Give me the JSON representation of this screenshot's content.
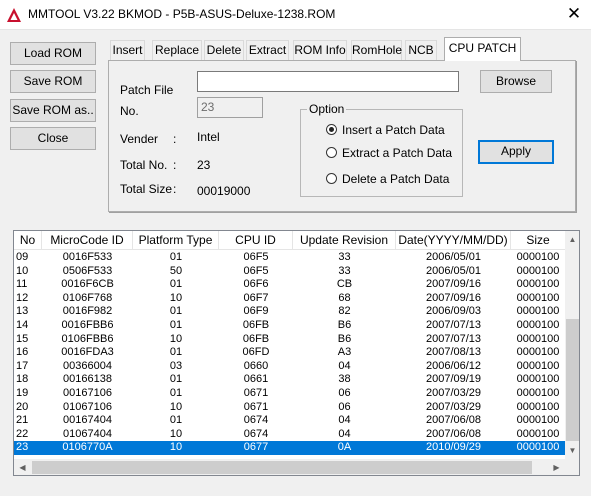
{
  "window": {
    "title": "MMTOOL V3.22 BKMOD - P5B-ASUS-Deluxe-1238.ROM",
    "close_glyph": "✕"
  },
  "side_buttons": [
    "Load ROM",
    "Save ROM",
    "Save ROM as..",
    "Close"
  ],
  "tabs": [
    "Insert",
    "Replace",
    "Delete",
    "Extract",
    "ROM Info",
    "RomHole",
    "NCB",
    "CPU PATCH"
  ],
  "active_tab": "CPU PATCH",
  "panel": {
    "patch_file_label": "Patch File",
    "patch_file_value": "",
    "browse_label": "Browse",
    "no_label": "No.",
    "no_value": "23",
    "vender_label": "Vender",
    "vender_colon": ":",
    "vender_value": "Intel",
    "total_no_label": "Total No.",
    "total_no_colon": ":",
    "total_no_value": "23",
    "total_size_label": "Total Size",
    "total_size_colon": ":",
    "total_size_value": "00019000",
    "option_title": "Option",
    "options": [
      "Insert a Patch Data",
      "Extract a Patch Data",
      "Delete a Patch Data"
    ],
    "selected_option": 0,
    "apply_label": "Apply"
  },
  "table": {
    "columns": [
      "No",
      "MicroCode ID",
      "Platform Type",
      "CPU ID",
      "Update Revision",
      "Date(YYYY/MM/DD)",
      "Size"
    ],
    "rows": [
      [
        "09",
        "0016F533",
        "01",
        "06F5",
        "33",
        "2006/05/01",
        "0000100"
      ],
      [
        "10",
        "0506F533",
        "50",
        "06F5",
        "33",
        "2006/05/01",
        "0000100"
      ],
      [
        "11",
        "0016F6CB",
        "01",
        "06F6",
        "CB",
        "2007/09/16",
        "0000100"
      ],
      [
        "12",
        "0106F768",
        "10",
        "06F7",
        "68",
        "2007/09/16",
        "0000100"
      ],
      [
        "13",
        "0016F982",
        "01",
        "06F9",
        "82",
        "2006/09/03",
        "0000100"
      ],
      [
        "14",
        "0016FBB6",
        "01",
        "06FB",
        "B6",
        "2007/07/13",
        "0000100"
      ],
      [
        "15",
        "0106FBB6",
        "10",
        "06FB",
        "B6",
        "2007/07/13",
        "0000100"
      ],
      [
        "16",
        "0016FDA3",
        "01",
        "06FD",
        "A3",
        "2007/08/13",
        "0000100"
      ],
      [
        "17",
        "00366004",
        "03",
        "0660",
        "04",
        "2006/06/12",
        "0000100"
      ],
      [
        "18",
        "00166138",
        "01",
        "0661",
        "38",
        "2007/09/19",
        "0000100"
      ],
      [
        "19",
        "00167106",
        "01",
        "0671",
        "06",
        "2007/03/29",
        "0000100"
      ],
      [
        "20",
        "01067106",
        "10",
        "0671",
        "06",
        "2007/03/29",
        "0000100"
      ],
      [
        "21",
        "00167404",
        "01",
        "0674",
        "04",
        "2007/06/08",
        "0000100"
      ],
      [
        "22",
        "01067404",
        "10",
        "0674",
        "04",
        "2007/06/08",
        "0000100"
      ],
      [
        "23",
        "0106770A",
        "10",
        "0677",
        "0A",
        "2010/09/29",
        "0000100"
      ]
    ],
    "selected_row": 14,
    "scroll_up_glyph": "▲",
    "scroll_down_glyph": "▼",
    "scroll_left_glyph": "◀",
    "scroll_right_glyph": "▶"
  },
  "colors": {
    "selection": "#0078d7",
    "icon_red": "#c8102e",
    "window_bg": "#f0f0f0"
  }
}
